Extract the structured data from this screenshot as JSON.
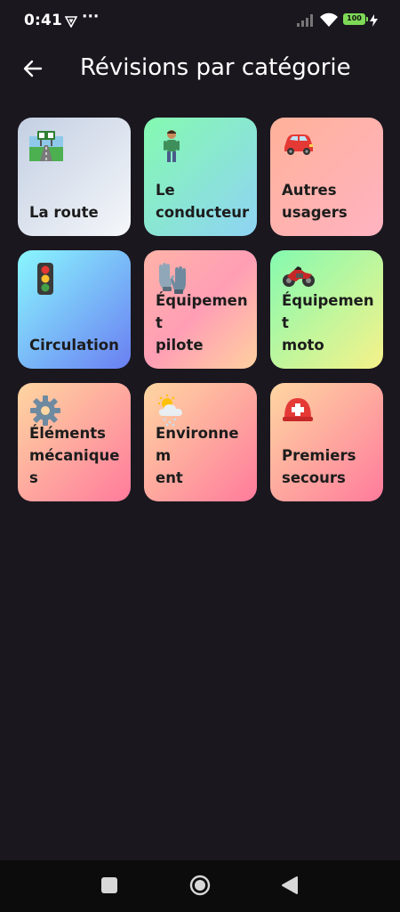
{
  "status_bar": {
    "time": "0:41",
    "overflow": "···",
    "battery": "100",
    "icons": [
      "vpn-icon",
      "signal-icon",
      "wifi-icon",
      "battery-icon",
      "charging-icon"
    ]
  },
  "header": {
    "title": "Révisions par catégorie",
    "back_icon": "arrow-left-icon"
  },
  "categories": [
    {
      "label": "La route",
      "icon": "motorway-icon",
      "gradient": [
        "#c3cfe2",
        "#f5f7fa"
      ]
    },
    {
      "label": "Le\nconducteur",
      "icon": "person-icon",
      "gradient": [
        "#84fab0",
        "#8fd3f4"
      ]
    },
    {
      "label": "Autres\nusagers",
      "icon": "car-icon",
      "gradient": [
        "#ffb199",
        "#ffb3c1"
      ]
    },
    {
      "label": "Circulation",
      "icon": "traffic-light-icon",
      "gradient": [
        "#89f7fe",
        "#6a7ff2"
      ]
    },
    {
      "label": "Équipement\npilote",
      "icon": "gloves-icon",
      "gradient": [
        "#ffb3a7",
        "#ff9eb5",
        "#ffd0a0"
      ]
    },
    {
      "label": "Équipement\nmoto",
      "icon": "motorcycle-icon",
      "gradient": [
        "#84fab0",
        "#f6f28a"
      ]
    },
    {
      "label": "Éléments\nmécaniques",
      "icon": "gear-icon",
      "gradient": [
        "#fed6a1",
        "#ff7b9c"
      ]
    },
    {
      "label": "Environnem\nent",
      "icon": "weather-icon",
      "gradient": [
        "#fed6a1",
        "#ff7b9c"
      ]
    },
    {
      "label": "Premiers\nsecours",
      "icon": "rescue-helmet-icon",
      "gradient": [
        "#fed6a1",
        "#ff7b9c"
      ]
    }
  ],
  "nav_bar": {
    "icons": [
      "recent-apps-icon",
      "home-icon",
      "back-triangle-icon"
    ]
  }
}
